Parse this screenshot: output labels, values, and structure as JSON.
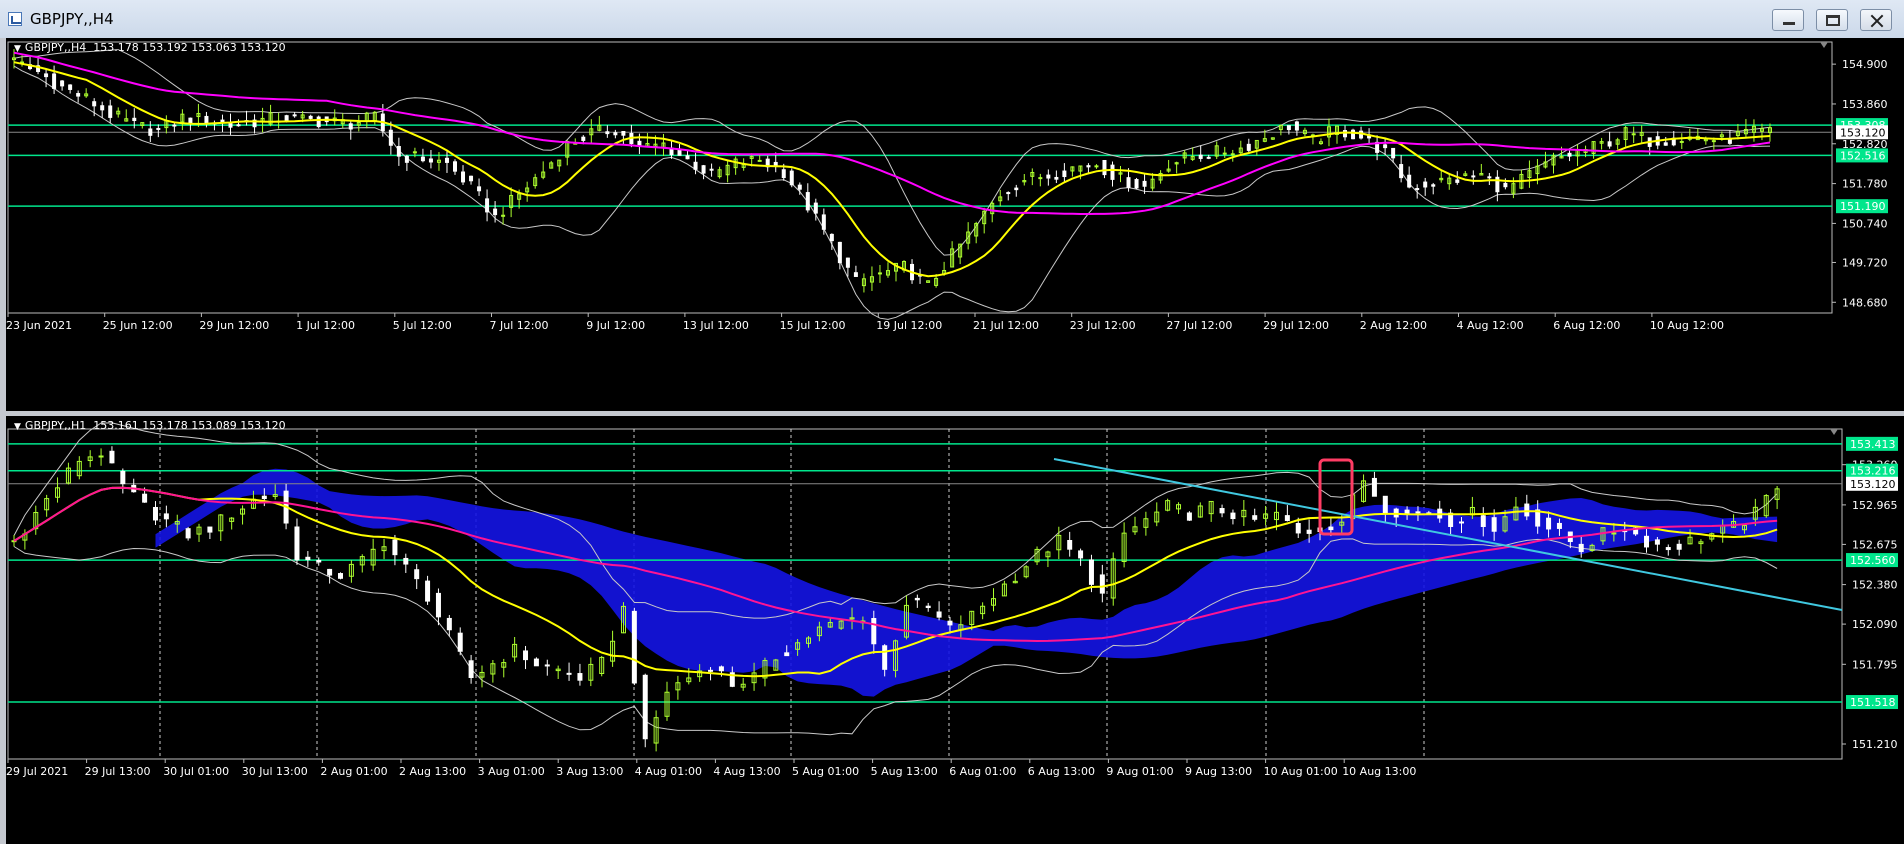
{
  "window": {
    "title": "GBPJPY,,H4"
  },
  "colors": {
    "background": "#000000",
    "bull_candle": "#adff2f",
    "bear_candle": "#ffffff",
    "level_line": "#00e68c",
    "ma_fast": "#ffff00",
    "ma_slow_h4": "#ff00ff",
    "ma_slow_h1": "#ff1493",
    "bollinger": "#c8c8c8",
    "cloud": "#1414e6",
    "trendline": "#40c8e0",
    "highlight_box": "#ff3c64"
  },
  "icons": [
    "chart-window-icon",
    "minimize-icon",
    "maximize-icon",
    "close-icon",
    "collapse-triangle-icon"
  ],
  "top_chart": {
    "header": "GBPJPY,,H4  153.178 153.192 153.063 153.120",
    "price_ticks": [
      "154.900",
      "153.860",
      "152.820",
      "151.780",
      "150.740",
      "149.720",
      "148.680"
    ],
    "level_labels": [
      "153.308",
      "153.120",
      "152.516",
      "151.190"
    ],
    "time_labels": [
      "23 Jun 2021",
      "25 Jun 12:00",
      "29 Jun 12:00",
      "1 Jul 12:00",
      "5 Jul 12:00",
      "7 Jul 12:00",
      "9 Jul 12:00",
      "13 Jul 12:00",
      "15 Jul 12:00",
      "19 Jul 12:00",
      "21 Jul 12:00",
      "23 Jul 12:00",
      "27 Jul 12:00",
      "29 Jul 12:00",
      "2 Aug 12:00",
      "4 Aug 12:00",
      "6 Aug 12:00",
      "10 Aug 12:00"
    ]
  },
  "bottom_chart": {
    "header": "GBPJPY,,H1  153.161 153.178 153.089 153.120",
    "price_ticks": [
      "153.260",
      "152.965",
      "152.675",
      "152.380",
      "152.090",
      "151.795",
      "151.210"
    ],
    "level_labels": [
      "153.413",
      "153.216",
      "153.120",
      "152.560",
      "151.518"
    ],
    "time_labels": [
      "29 Jul 2021",
      "29 Jul 13:00",
      "30 Jul 01:00",
      "30 Jul 13:00",
      "2 Aug 01:00",
      "2 Aug 13:00",
      "3 Aug 01:00",
      "3 Aug 13:00",
      "4 Aug 01:00",
      "4 Aug 13:00",
      "5 Aug 01:00",
      "5 Aug 13:00",
      "6 Aug 01:00",
      "6 Aug 13:00",
      "9 Aug 01:00",
      "9 Aug 13:00",
      "10 Aug 01:00",
      "10 Aug 13:00"
    ]
  },
  "chart_data": [
    {
      "type": "candlestick",
      "title": "GBPJPY,,H4",
      "ylim": [
        148.4,
        155.4
      ],
      "levels": [
        153.308,
        152.516,
        151.19
      ],
      "last_price": 153.12,
      "close_path": [
        154.95,
        154.7,
        154.3,
        154.0,
        153.6,
        153.3,
        153.15,
        153.5,
        153.45,
        153.3,
        153.4,
        153.5,
        153.45,
        153.4,
        153.35,
        153.5,
        152.5,
        152.45,
        152.3,
        151.7,
        150.9,
        151.5,
        152.1,
        152.8,
        153.1,
        153.2,
        152.7,
        152.8,
        152.4,
        152.0,
        152.3,
        152.4,
        152.1,
        151.2,
        150.2,
        149.2,
        149.4,
        149.6,
        149.1,
        149.9,
        150.7,
        151.5,
        151.9,
        152.0,
        152.2,
        152.3,
        151.9,
        151.7,
        152.3,
        152.5,
        152.6,
        152.7,
        153.0,
        153.3,
        152.9,
        153.2,
        153.0,
        152.6,
        151.7,
        151.8,
        151.9,
        152.0,
        151.6,
        152.0,
        152.4,
        152.6,
        152.8,
        153.1,
        152.9,
        152.95,
        153.0,
        152.9,
        153.1,
        153.12
      ]
    },
    {
      "type": "candlestick",
      "title": "GBPJPY,,H1",
      "ylim": [
        151.1,
        153.5
      ],
      "levels": [
        153.413,
        153.216,
        152.56,
        151.518
      ],
      "last_price": 153.12,
      "close_path": [
        152.7,
        152.9,
        153.1,
        153.3,
        153.35,
        153.1,
        152.95,
        152.85,
        152.75,
        152.8,
        152.9,
        153.0,
        153.05,
        152.6,
        152.5,
        152.45,
        152.55,
        152.7,
        152.5,
        152.3,
        152.0,
        151.7,
        151.8,
        151.9,
        151.8,
        151.75,
        151.7,
        151.8,
        152.2,
        151.2,
        151.6,
        151.7,
        151.8,
        151.65,
        151.7,
        151.85,
        151.95,
        152.05,
        152.1,
        152.15,
        151.75,
        152.25,
        152.2,
        152.05,
        152.15,
        152.3,
        152.45,
        152.6,
        152.7,
        152.55,
        152.3,
        152.75,
        152.85,
        152.95,
        152.9,
        152.95,
        152.9,
        152.85,
        152.9,
        152.75,
        152.8,
        152.85,
        153.15,
        152.95,
        152.9,
        152.92,
        152.85,
        152.9,
        152.8,
        152.95,
        152.85,
        152.75,
        152.65,
        152.75,
        152.8,
        152.7,
        152.65,
        152.7,
        152.75,
        152.8,
        152.9,
        153.12
      ]
    }
  ]
}
